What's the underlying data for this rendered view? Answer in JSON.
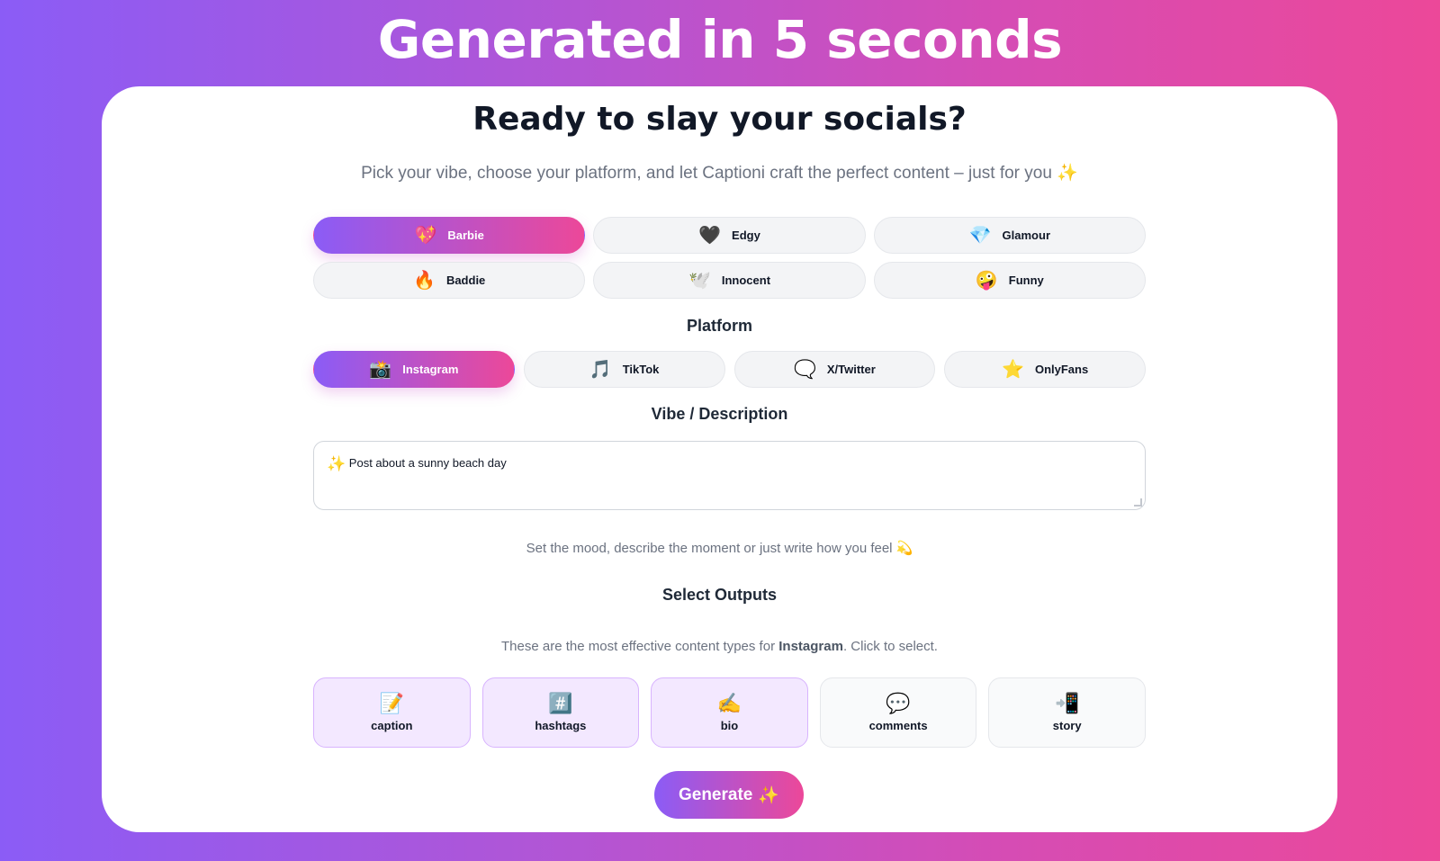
{
  "headline": "Generated in 5 seconds",
  "card": {
    "title": "Ready to slay your socials?",
    "subtitle": "Pick your vibe, choose your platform, and let Captioni craft the perfect content – just for you ✨"
  },
  "vibes": [
    {
      "emoji": "💖",
      "label": "Barbie",
      "active": true
    },
    {
      "emoji": "🖤",
      "label": "Edgy",
      "active": false
    },
    {
      "emoji": "💎",
      "label": "Glamour",
      "active": false
    },
    {
      "emoji": "🔥",
      "label": "Baddie",
      "active": false
    },
    {
      "emoji": "🕊️",
      "label": "Innocent",
      "active": false
    },
    {
      "emoji": "🤪",
      "label": "Funny",
      "active": false
    }
  ],
  "platform": {
    "label": "Platform",
    "items": [
      {
        "emoji": "📸",
        "label": "Instagram",
        "active": true
      },
      {
        "emoji": "🎵",
        "label": "TikTok",
        "active": false
      },
      {
        "emoji": "🗨️",
        "label": "X/Twitter",
        "active": false
      },
      {
        "emoji": "⭐",
        "label": "OnlyFans",
        "active": false
      }
    ]
  },
  "description": {
    "label": "Vibe / Description",
    "emoji": "✨",
    "value": "Post about a sunny beach day",
    "helper": "Set the mood, describe the moment or just write how you feel 💫"
  },
  "outputs": {
    "label": "Select Outputs",
    "hint_prefix": "These are the most effective content types for ",
    "hint_platform": "Instagram",
    "hint_suffix": ". Click to select.",
    "items": [
      {
        "emoji": "📝",
        "label": "caption",
        "selected": true
      },
      {
        "emoji": "#️⃣",
        "label": "hashtags",
        "selected": true
      },
      {
        "emoji": "✍️",
        "label": "bio",
        "selected": true
      },
      {
        "emoji": "💬",
        "label": "comments",
        "selected": false
      },
      {
        "emoji": "📲",
        "label": "story",
        "selected": false
      }
    ]
  },
  "generate": {
    "label": "Generate",
    "emoji": "✨"
  },
  "colors": {
    "gradient_start": "#8b5cf6",
    "gradient_end": "#ec4899",
    "selected_tile": "#f3e8ff"
  }
}
